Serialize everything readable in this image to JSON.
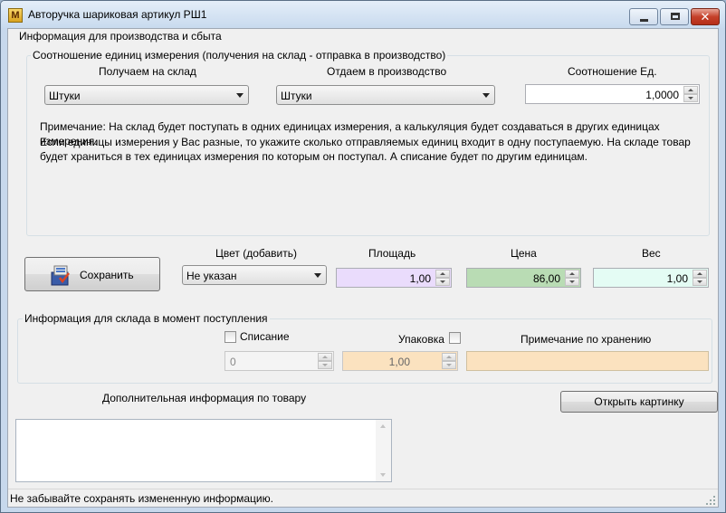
{
  "window": {
    "title": "Авторучка шариковая артикул РШ1",
    "icon_glyph": "M"
  },
  "production": {
    "group_title": "Информация для производства и сбыта",
    "ratio_group_title": "Соотношение единиц измерения (получения на склад - отправка в производство)",
    "receive_label": "Получаем на склад",
    "receive_value": "Штуки",
    "send_label": "Отдаем в производство",
    "send_value": "Штуки",
    "ratio_label": "Соотношение Ед.",
    "ratio_value": "1,0000",
    "note_line1": "Примечание: На склад будет поступать в одних единицах измерения, а калькуляция будет создаваться в других единицах измерения.",
    "note_line2": "Если единицы измерения у Вас разные, то укажите сколько отправляемых единиц входит в одну поступаемую. На складе товар",
    "note_line3": "будет храниться в тех единицах измерения по которым он поступал. А списание будет по другим единицам."
  },
  "attributes": {
    "save_label": "Сохранить",
    "color_label": "Цвет (добавить)",
    "color_value": "Не указан",
    "area_label": "Площадь",
    "area_value": "1,00",
    "price_label": "Цена",
    "price_value": "86,00",
    "weight_label": "Вес",
    "weight_value": "1,00"
  },
  "warehouse": {
    "group_title": "Информация для склада в момент поступления",
    "writeoff_label": "Списание",
    "writeoff_value": "0",
    "pack_label": "Упаковка",
    "pack_value": "1,00",
    "storage_note_label": "Примечание по хранению",
    "storage_note_value": ""
  },
  "extra": {
    "info_label": "Дополнительная информация по товару",
    "open_picture_label": "Открыть картинку",
    "info_value": ""
  },
  "status": {
    "text": "Не забывайте сохранять измененную информацию."
  },
  "colors": {
    "area_bg": "#eadcfc",
    "price_bg": "#b9dcb4",
    "weight_bg": "#e4fcf4",
    "pack_bg": "#fbe2bf",
    "storage_bg": "#fbe2bf"
  }
}
